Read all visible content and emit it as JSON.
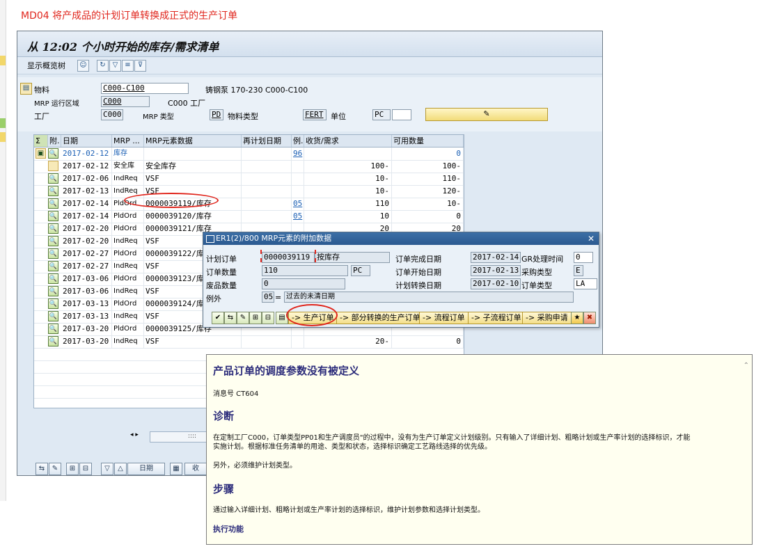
{
  "caption": "MD04    将产成品的计划订单转换成正式的生产订单",
  "window": {
    "title": "从 12:02 个小时开始的库存/需求清单",
    "toolbar_label": "显示概览树"
  },
  "header": {
    "material_label": "物料",
    "material_value": "C000-C100",
    "material_desc": "铸钢泵 170-230 C000-C100",
    "mrp_area_label": "MRP 运行区域",
    "mrp_area_value": "C000",
    "mrp_area_desc": "C000 工厂",
    "plant_label": "工厂",
    "plant_value": "C000",
    "mrp_type_label": "MRP 类型",
    "mrp_type_value": "PD",
    "material_type_label": "物料类型",
    "material_type_value": "FERT",
    "unit_label": "单位",
    "unit_value": "PC"
  },
  "grid": {
    "columns": [
      "附.",
      "日期",
      "MRP ...",
      "MRP元素数据",
      "再计划日期",
      "例.",
      "收货/需求",
      "可用数量"
    ],
    "rows": [
      {
        "date": "2017-02-12",
        "element": "库存",
        "data": "",
        "exc": "96",
        "qty": "",
        "avail": "0",
        "blue": true
      },
      {
        "date": "2017-02-12",
        "element": "安全库",
        "data": "安全库存",
        "exc": "",
        "qty": "100-",
        "avail": "100-"
      },
      {
        "date": "2017-02-06",
        "element": "IndReq",
        "data": "VSF",
        "exc": "",
        "qty": "10-",
        "avail": "110-"
      },
      {
        "date": "2017-02-13",
        "element": "IndReq",
        "data": "VSF",
        "exc": "",
        "qty": "10-",
        "avail": "120-"
      },
      {
        "date": "2017-02-14",
        "element": "PldOrd",
        "data": "0000039119/库存",
        "exc": "05",
        "qty": "110",
        "avail": "10-"
      },
      {
        "date": "2017-02-14",
        "element": "PldOrd",
        "data": "0000039120/库存",
        "exc": "05",
        "qty": "10",
        "avail": "0"
      },
      {
        "date": "2017-02-20",
        "element": "PldOrd",
        "data": "0000039121/库存",
        "exc": "",
        "qty": "20",
        "avail": "20"
      },
      {
        "date": "2017-02-20",
        "element": "IndReq",
        "data": "VSF",
        "exc": "",
        "qty": "",
        "avail": ""
      },
      {
        "date": "2017-02-27",
        "element": "PldOrd",
        "data": "0000039122/库存",
        "exc": "",
        "qty": "",
        "avail": ""
      },
      {
        "date": "2017-02-27",
        "element": "IndReq",
        "data": "VSF",
        "exc": "",
        "qty": "",
        "avail": ""
      },
      {
        "date": "2017-03-06",
        "element": "PldOrd",
        "data": "0000039123/库存",
        "exc": "",
        "qty": "",
        "avail": ""
      },
      {
        "date": "2017-03-06",
        "element": "IndReq",
        "data": "VSF",
        "exc": "",
        "qty": "",
        "avail": ""
      },
      {
        "date": "2017-03-13",
        "element": "PldOrd",
        "data": "0000039124/库存",
        "exc": "",
        "qty": "",
        "avail": ""
      },
      {
        "date": "2017-03-13",
        "element": "IndReq",
        "data": "VSF",
        "exc": "",
        "qty": "",
        "avail": ""
      },
      {
        "date": "2017-03-20",
        "element": "PldOrd",
        "data": "0000039125/库存",
        "exc": "",
        "qty": "",
        "avail": ""
      },
      {
        "date": "2017-03-20",
        "element": "IndReq",
        "data": "VSF",
        "exc": "",
        "qty": "20-",
        "avail": "0"
      }
    ],
    "scroll_arrows": "◂ ▸",
    "scroll_thumb": "::::"
  },
  "bottom": {
    "date_label": "日期",
    "receipt_label": "收"
  },
  "dialog": {
    "title": "ER1(2)/800 MRP元素的附加数据",
    "planned_order_label": "计划订单",
    "planned_order_value": "0000039119",
    "planned_order_desc": "按库存",
    "order_finish_label": "订单完成日期",
    "order_finish_value": "2017-02-14",
    "gr_time_label": "GR处理时间",
    "gr_time_value": "0",
    "order_qty_label": "订单数量",
    "order_qty_value": "110",
    "order_qty_unit": "PC",
    "order_start_label": "订单开始日期",
    "order_start_value": "2017-02-13",
    "proc_type_label": "采购类型",
    "proc_type_value": "E",
    "scrap_label": "废品数量",
    "scrap_value": "0",
    "plan_conv_label": "计划转换日期",
    "plan_conv_value": "2017-02-10",
    "order_type_label": "订单类型",
    "order_type_value": "LA",
    "exception_label": "例外",
    "exception_value": "05",
    "exception_desc": "过去的未清日期",
    "buttons": [
      "-> 生产订单",
      "-> 部分转换的生产订单",
      "-> 流程订单",
      "-> 子流程订单",
      "-> 采购申请"
    ]
  },
  "help": {
    "title": "产品订单的调度参数没有被定义",
    "msg_no": "消息号 CT604",
    "diag_heading": "诊断",
    "diag_text1": "在定制工厂C000，订单类型PP01和生产调度员\"的过程中，没有为生产订单定义计划级别。只有输入了详细计划、粗略计划或生产率计划的选择标识，才能",
    "diag_text2": "实施计划。根据标准任务清单的用途、类型和状态，选择标识确定工艺路线选择的优先级。",
    "also_text": "另外，必须维护计划类型。",
    "steps_heading": "步骤",
    "steps_text": "通过输入详细计划、粗略计划或生产率计划的选择标识，维护计划参数和选择计划类型。",
    "exec_link": "执行功能"
  },
  "colors": {
    "annotation": "#e0261d",
    "dialog_title": "#2b5990",
    "help_heading": "#2b2b7a"
  }
}
